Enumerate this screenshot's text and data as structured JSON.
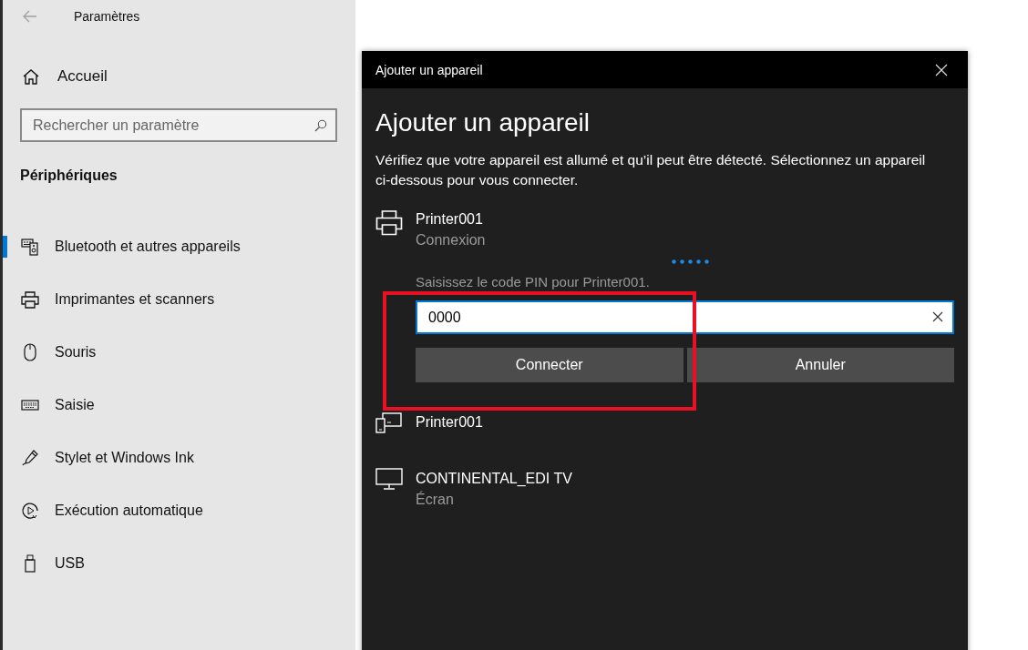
{
  "settings": {
    "title": "Paramètres",
    "home": "Accueil",
    "search": {
      "placeholder": "Rechercher un paramètre"
    },
    "section": "Périphériques",
    "nav": [
      {
        "label": "Bluetooth et autres appareils",
        "kind": "bluetooth",
        "selected": true
      },
      {
        "label": "Imprimantes et scanners",
        "kind": "printer",
        "selected": false
      },
      {
        "label": "Souris",
        "kind": "mouse",
        "selected": false
      },
      {
        "label": "Saisie",
        "kind": "keyboard",
        "selected": false
      },
      {
        "label": "Stylet et Windows Ink",
        "kind": "pen",
        "selected": false
      },
      {
        "label": "Exécution automatique",
        "kind": "autoplay",
        "selected": false
      },
      {
        "label": "USB",
        "kind": "usb",
        "selected": false
      }
    ]
  },
  "dialog": {
    "title": "Ajouter un appareil",
    "heading": "Ajouter un appareil",
    "description": "Vérifiez que votre appareil est allumé et qu’il peut être détecté. Sélectionnez un appareil ci-dessous pour vous connecter.",
    "devices": [
      {
        "name": "Printer001",
        "status": "Connexion",
        "kind": "printer",
        "pairing": {
          "prompt": "Saisissez le code PIN pour Printer001.",
          "pin": "0000",
          "buttons": [
            "Connecter",
            "Annuler"
          ]
        }
      },
      {
        "name": "Printer001",
        "kind": "devices"
      },
      {
        "name": "CONTINENTAL_EDI TV",
        "status": "Écran",
        "kind": "monitor"
      }
    ]
  }
}
